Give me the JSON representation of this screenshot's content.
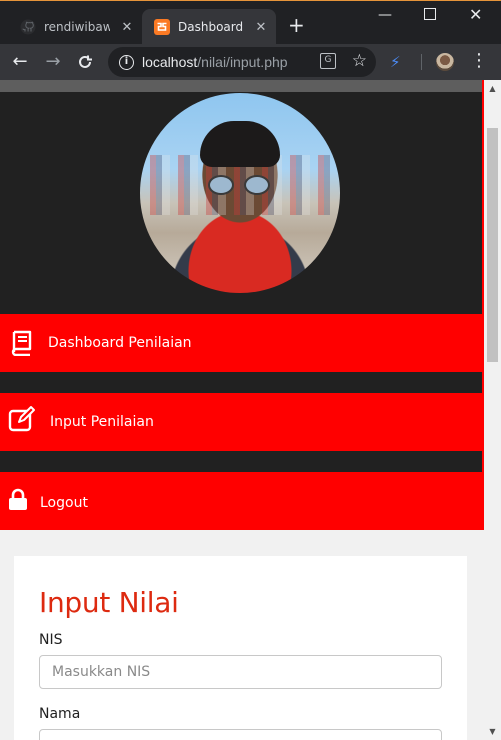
{
  "browser": {
    "tabs": [
      {
        "title": "rendiwibawa",
        "active": false,
        "icon": "github-icon"
      },
      {
        "title": "Dashboard ko",
        "active": true,
        "icon": "xampp-icon"
      }
    ],
    "new_tab_icon": "plus-icon",
    "url_host": "localhost",
    "url_path": "/nilai/input.php",
    "window_controls": [
      "minimize",
      "maximize",
      "close"
    ]
  },
  "sidebar": {
    "items": [
      {
        "label": "Dashboard Penilaian",
        "icon": "book-icon"
      },
      {
        "label": "Input Penilaian",
        "icon": "edit-icon"
      },
      {
        "label": "Logout",
        "icon": "lock-icon"
      }
    ]
  },
  "form": {
    "title": "Input Nilai",
    "nis_label": "NIS",
    "nis_placeholder": "Masukkan NIS",
    "nama_label": "Nama"
  },
  "colors": {
    "accent": "#ff0000",
    "sidebar_bg": "#212121",
    "title_color": "#dd2a10"
  }
}
